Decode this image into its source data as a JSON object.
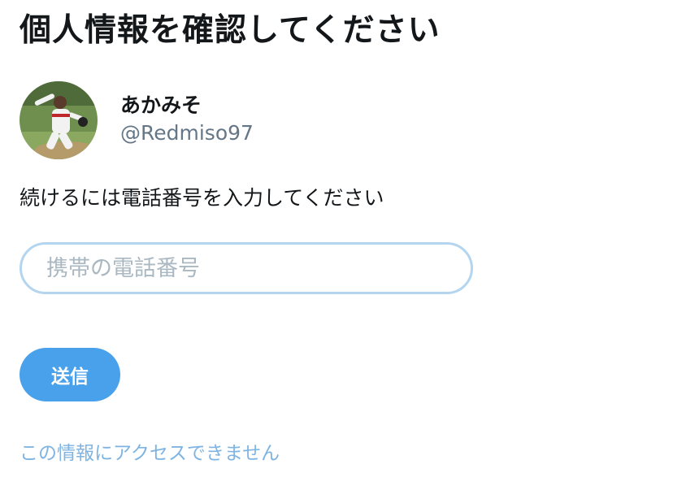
{
  "header": {
    "title": "個人情報を確認してください"
  },
  "profile": {
    "display_name": "あかみそ",
    "handle": "@Redmiso97"
  },
  "form": {
    "instruction": "続けるには電話番号を入力してください",
    "phone_placeholder": "携帯の電話番号",
    "phone_value": "",
    "submit_label": "送信"
  },
  "footer": {
    "no_access_link": "この情報にアクセスできません"
  },
  "colors": {
    "accent": "#4aa1eb",
    "link": "#7fb4e2",
    "input_border": "#b3d5f0",
    "text_primary": "#14171a",
    "text_secondary": "#657786"
  }
}
